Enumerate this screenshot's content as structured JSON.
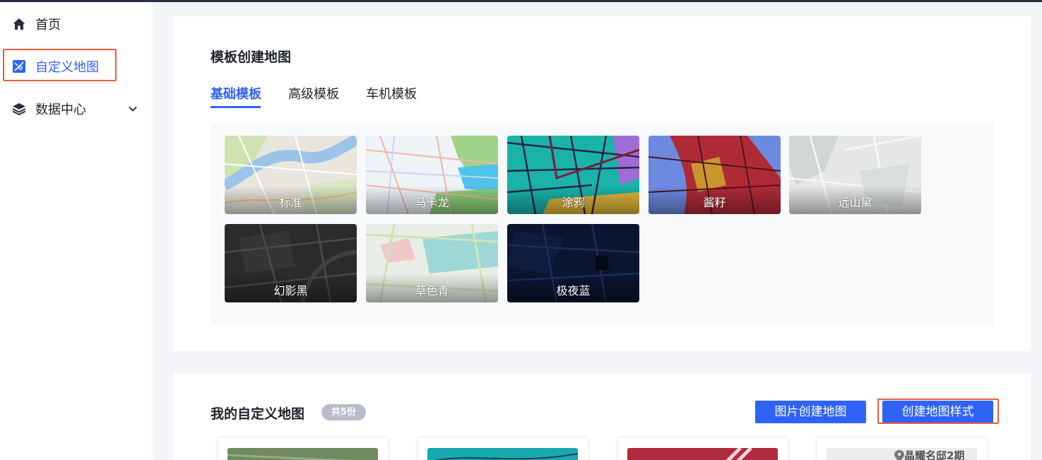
{
  "sidebar": {
    "items": [
      {
        "label": "首页",
        "icon": "home-icon"
      },
      {
        "label": "自定义地图",
        "icon": "custom-map-icon",
        "active": true
      },
      {
        "label": "数据中心",
        "icon": "layers-icon",
        "has_submenu": true
      }
    ]
  },
  "templates": {
    "title": "模板创建地图",
    "tabs": [
      "基础模板",
      "高级模板",
      "车机模板"
    ],
    "active_tab": "基础模板",
    "items": [
      {
        "name": "标准"
      },
      {
        "name": "马卡龙"
      },
      {
        "name": "涂鸦"
      },
      {
        "name": "酱籽"
      },
      {
        "name": "远山黛"
      },
      {
        "name": "幻影黑"
      },
      {
        "name": "草色青"
      },
      {
        "name": "极夜蓝"
      }
    ]
  },
  "my_maps": {
    "title": "我的自定义地图",
    "count_badge": "共5份",
    "buttons": {
      "create_from_image": "图片创建地图",
      "create_style": "创建地图样式"
    },
    "partial_label": "晶耀名邸2期"
  },
  "colors": {
    "accent": "#2f63f6",
    "highlight_box": "#ef5a3a",
    "badge": "#b8bcc8"
  }
}
